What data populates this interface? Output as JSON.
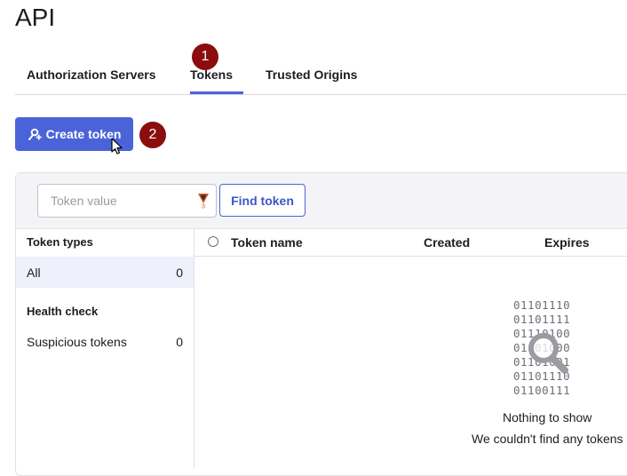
{
  "page": {
    "title": "API"
  },
  "tabs": [
    {
      "label": "Authorization Servers",
      "active": false
    },
    {
      "label": "Tokens",
      "active": true
    },
    {
      "label": "Trusted Origins",
      "active": false
    }
  ],
  "steps": {
    "step1": "1",
    "step2": "2"
  },
  "actions": {
    "create_token_label": "Create token"
  },
  "search": {
    "placeholder": "Token value",
    "value": "",
    "find_label": "Find token"
  },
  "sidebar": {
    "token_types_heading": "Token types",
    "token_types": [
      {
        "label": "All",
        "count": "0",
        "selected": true
      }
    ],
    "health_check_heading": "Health check",
    "health_check": [
      {
        "label": "Suspicious tokens",
        "count": "0"
      }
    ]
  },
  "table": {
    "columns": [
      "Token name",
      "Created",
      "Expires"
    ],
    "rows": []
  },
  "empty_state": {
    "binary_lines": [
      "01101110",
      "01101111",
      "01110100",
      "01101000",
      "01101001",
      "01101110",
      "01100111"
    ],
    "title": "Nothing to show",
    "subtitle": "We couldn't find any tokens"
  },
  "colors": {
    "primary": "#4b63d8",
    "step_badge": "#8b0d0d",
    "selected_row": "#eef0fb"
  },
  "icons": {
    "create": "key-plus-icon",
    "search_extension": "extension-badge-icon",
    "empty": "magnifier-icon",
    "pointer": "mouse-cursor-icon"
  }
}
